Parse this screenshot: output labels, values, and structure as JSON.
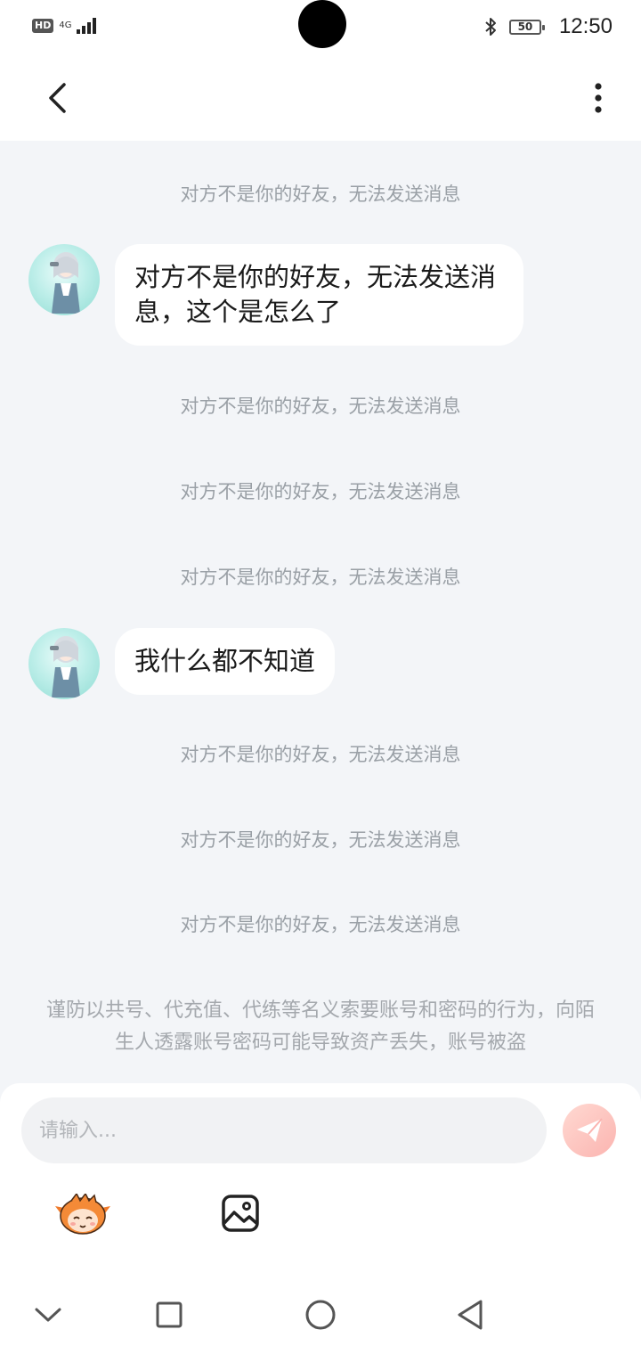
{
  "status_bar": {
    "hd": "HD",
    "network": "4G",
    "battery": "50",
    "time": "12:50"
  },
  "icons": {
    "back": "back-arrow-icon",
    "more": "more-vertical-icon",
    "send": "send-plane-icon",
    "emoji": "emoji-mascot-icon",
    "image": "image-icon"
  },
  "chat": {
    "system_notices": [
      "对方不是你的好友，无法发送消息",
      "对方不是你的好友，无法发送消息",
      "对方不是你的好友，无法发送消息",
      "对方不是你的好友，无法发送消息",
      "对方不是你的好友，无法发送消息",
      "对方不是你的好友，无法发送消息",
      "对方不是你的好友，无法发送消息"
    ],
    "messages": [
      {
        "text": "对方不是你的好友，无法发送消息，这个是怎么了"
      },
      {
        "text": "我什么都不知道"
      }
    ],
    "safety_notice": "谨防以共号、代充值、代练等名义索要账号和密码的行为，向陌生人透露账号密码可能导致资产丢失，账号被盗"
  },
  "input": {
    "placeholder": "请输入...",
    "value": ""
  },
  "colors": {
    "chat_background": "#f3f5f8",
    "system_text": "#9aa0a6",
    "send_button": "#fbb4b0"
  }
}
